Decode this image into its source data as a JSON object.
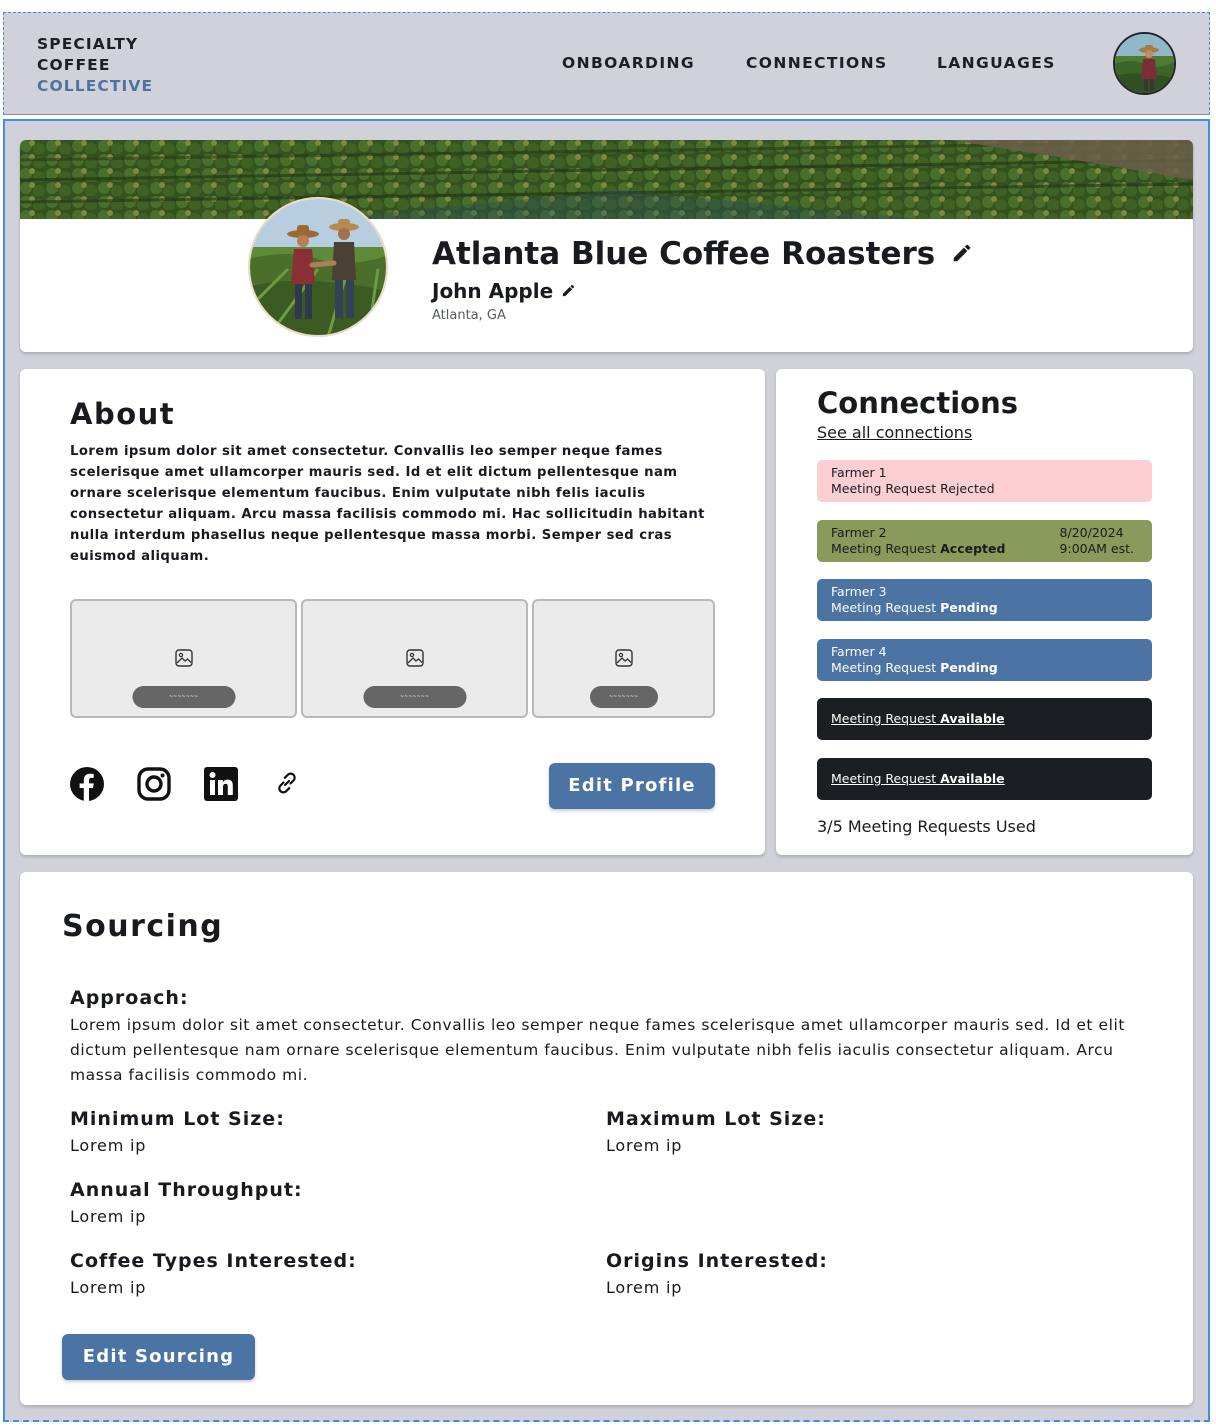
{
  "header": {
    "logo_line1": "SPECIALTY",
    "logo_line2": "COFFEE",
    "logo_line3": "COLLECTIVE",
    "nav": [
      "ONBOARDING",
      "CONNECTIONS",
      "LANGUAGES"
    ]
  },
  "profile": {
    "org_name": "Atlanta Blue Coffee Roasters",
    "person_name": "John Apple",
    "location": "Atlanta, GA"
  },
  "about": {
    "title": "About",
    "text": "Lorem ipsum dolor sit amet consectetur. Convallis leo semper neque fames scelerisque amet ullamcorper mauris sed. Id et elit dictum pellentesque nam ornare scelerisque elementum faucibus. Enim vulputate nibh felis iaculis consectetur aliquam. Arcu massa facilisis commodo mi. Hac sollicitudin habitant nulla interdum phasellus neque pellentesque massa morbi. Semper sed cras euismod aliquam.",
    "gallery": [
      {
        "caption": "~~~~~~~"
      },
      {
        "caption": "~~~~~~~"
      },
      {
        "caption": "~~~~~~~"
      }
    ],
    "social_icons": [
      "facebook-icon",
      "instagram-icon",
      "linkedin-icon",
      "link-icon"
    ],
    "edit_button": "Edit Profile"
  },
  "connections": {
    "title": "Connections",
    "see_all": "See all connections",
    "items": [
      {
        "farmer": "Farmer 1",
        "status_prefix": "Meeting Request ",
        "status": "Rejected",
        "state": "rejected"
      },
      {
        "farmer": "Farmer 2",
        "status_prefix": "Meeting Request ",
        "status": "Accepted",
        "state": "accepted",
        "date": "8/20/2024",
        "time": "9:00AM est."
      },
      {
        "farmer": "Farmer 3",
        "status_prefix": "Meeting Request ",
        "status": "Pending",
        "state": "pending"
      },
      {
        "farmer": "Farmer 4",
        "status_prefix": "Meeting Request ",
        "status": "Pending",
        "state": "pending"
      },
      {
        "status_prefix": "Meeting Request ",
        "status": "Available",
        "state": "available"
      },
      {
        "status_prefix": "Meeting Request ",
        "status": "Available",
        "state": "available"
      }
    ],
    "used_text": "3/5 Meeting Requests Used"
  },
  "sourcing": {
    "title": "Sourcing",
    "approach_label": "Approach:",
    "approach_text": "Lorem ipsum dolor sit amet consectetur. Convallis leo semper neque fames scelerisque amet ullamcorper mauris sed. Id et elit dictum pellentesque nam ornare scelerisque elementum faucibus. Enim vulputate nibh felis iaculis consectetur aliquam. Arcu massa facilisis commodo mi.",
    "min_lot_label": "Minimum Lot Size:",
    "min_lot_value": "Lorem ip",
    "max_lot_label": "Maximum Lot Size:",
    "max_lot_value": "Lorem ip",
    "throughput_label": "Annual Throughput:",
    "throughput_value": "Lorem ip",
    "coffee_types_label": "Coffee Types Interested:",
    "coffee_types_value": "Lorem ip",
    "origins_label": "Origins Interested:",
    "origins_value": "Lorem ip",
    "edit_button": "Edit Sourcing"
  },
  "colors": {
    "accent_blue": "#4b73a3",
    "page_gray": "#d0d1d9",
    "rejected": "#fccfd3",
    "accepted": "#8a9a5b",
    "pending": "#4b73a3",
    "available": "#1b1e22"
  }
}
